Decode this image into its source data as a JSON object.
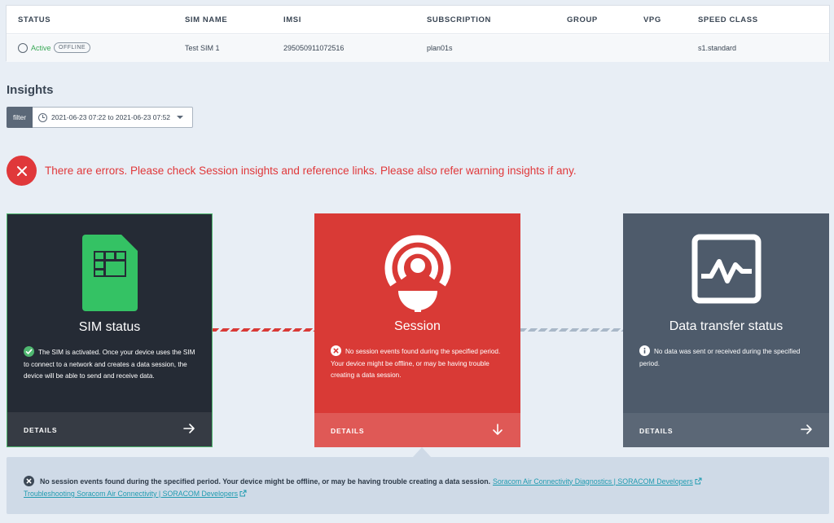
{
  "sim_table": {
    "headers": {
      "status": "STATUS",
      "sim_name": "SIM NAME",
      "imsi": "IMSI",
      "subscription": "SUBSCRIPTION",
      "group": "GROUP",
      "vpg": "VPG",
      "speed_class": "SPEED CLASS"
    },
    "row": {
      "status": "Active",
      "status_badge": "OFFLINE",
      "sim_name": "Test SIM 1",
      "imsi": "295050911072516",
      "subscription": "plan01s",
      "group": "",
      "vpg": "",
      "speed_class": "s1.standard"
    }
  },
  "insights": {
    "title": "Insights",
    "filter_label": "filter",
    "filter_range": "2021-06-23 07:22 to 2021-06-23 07:52"
  },
  "error_banner": {
    "text": "There are errors. Please check Session insights and reference links. Please also refer warning insights if any."
  },
  "cards": {
    "sim": {
      "title": "SIM status",
      "description": "The SIM is activated. Once your device uses the SIM to connect to a network and creates a data session, the device will be able to send and receive data.",
      "details_label": "DETAILS",
      "icon": "sim-card-icon"
    },
    "session": {
      "title": "Session",
      "description": "No session events found during the specified period. Your device might be offline, or may be having trouble creating a data session.",
      "details_label": "DETAILS",
      "icon": "antenna-icon"
    },
    "data": {
      "title": "Data transfer status",
      "description": "No data was sent or received during the specified period.",
      "details_label": "DETAILS",
      "icon": "line-chart-icon"
    }
  },
  "info_panel": {
    "message": "No session events found during the specified period. Your device might be offline, or may be having trouble creating a data session.",
    "link1": "Soracom Air Connectivity Diagnostics | SORACOM Developers",
    "link2": "Troubleshooting Soracom Air Connectivity | SORACOM Developers"
  },
  "colors": {
    "error": "#e0383a",
    "success": "#4fb870",
    "session_card": "#d93a36",
    "sim_card": "#252b35",
    "data_card": "#4e5b6b",
    "link": "#1f9bb0"
  }
}
